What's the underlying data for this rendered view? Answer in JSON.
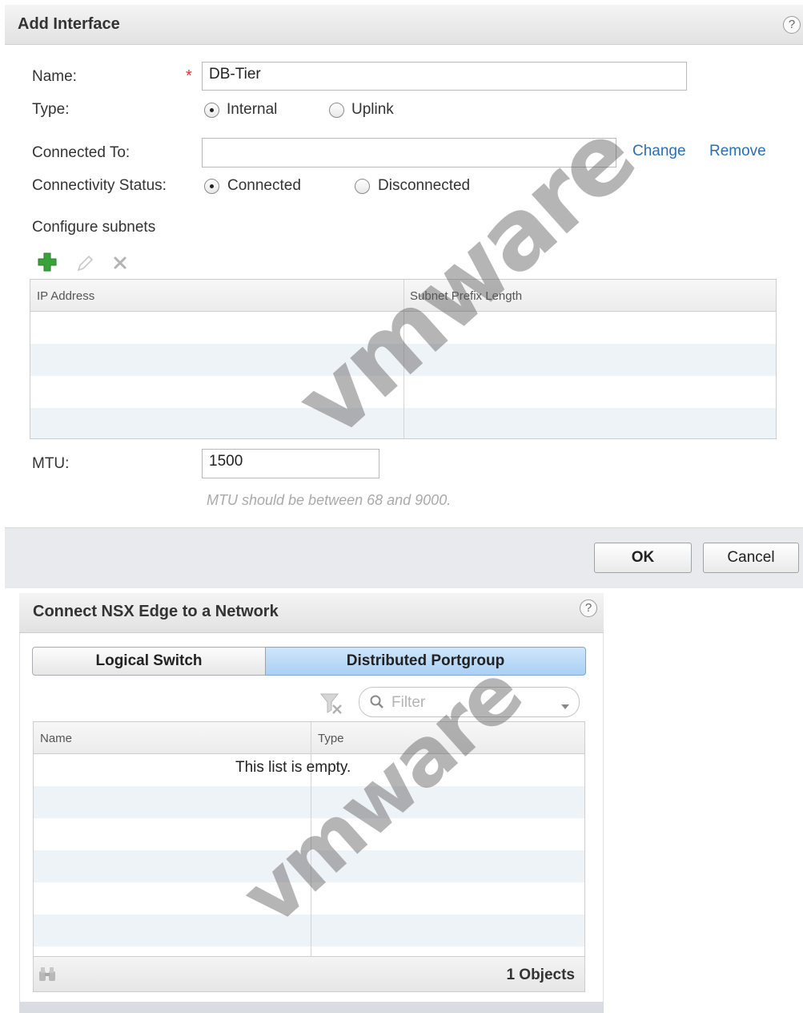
{
  "add_interface": {
    "title": "Add Interface",
    "help_label": "?",
    "name_label": "Name:",
    "required_marker": "*",
    "name_value": "DB-Tier",
    "type_label": "Type:",
    "type_options": [
      "Internal",
      "Uplink"
    ],
    "type_selected": "Internal",
    "connected_to_label": "Connected To:",
    "connected_to_value": "",
    "change_link": "Change",
    "remove_link": "Remove",
    "connectivity_label": "Connectivity Status:",
    "connectivity_options": [
      "Connected",
      "Disconnected"
    ],
    "connectivity_selected": "Connected",
    "configure_subnets_label": "Configure subnets",
    "toolbar_icons": [
      "add-icon",
      "edit-icon",
      "delete-icon"
    ],
    "subnet_columns": [
      "IP Address",
      "Subnet Prefix Length"
    ],
    "subnet_rows": [],
    "mtu_label": "MTU:",
    "mtu_value": "1500",
    "mtu_hint": "MTU should be between 68 and 9000.",
    "ok_label": "OK",
    "cancel_label": "Cancel"
  },
  "connect_edge": {
    "title": "Connect NSX Edge to a Network",
    "help_label": "?",
    "tabs": [
      "Logical Switch",
      "Distributed Portgroup"
    ],
    "active_tab": "Distributed Portgroup",
    "filter_placeholder": "Filter",
    "columns": [
      "Name",
      "Type"
    ],
    "empty_text": "This list is empty.",
    "object_count": "1 Objects"
  },
  "watermark_text": "vmware",
  "colors": {
    "link": "#2a6fb5",
    "required": "#e03030",
    "active_tab": "#b9dbf8",
    "add_icon": "#3aa23a"
  }
}
